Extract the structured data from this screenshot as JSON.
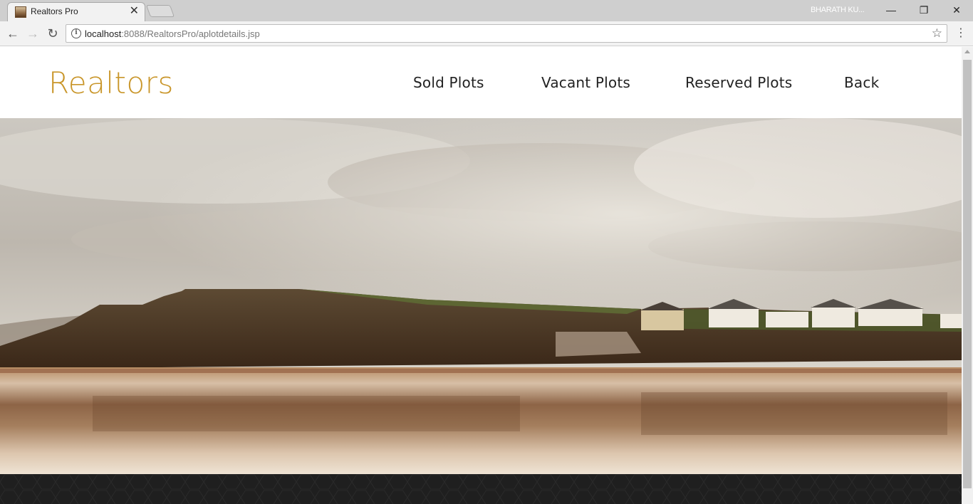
{
  "browser": {
    "tab_title": "Realtors Pro",
    "profile_name": "BHARATH KU...",
    "url_host": "localhost",
    "url_path": ":8088/RealtorsPro/aplotdetails.jsp"
  },
  "site": {
    "brand": "Realtors",
    "nav": {
      "sold": "Sold Plots",
      "vacant": "Vacant Plots",
      "reserved": "Reserved Plots",
      "back": "Back"
    },
    "colors": {
      "brand": "#c9962a",
      "footer": "#1f1f1f"
    }
  }
}
